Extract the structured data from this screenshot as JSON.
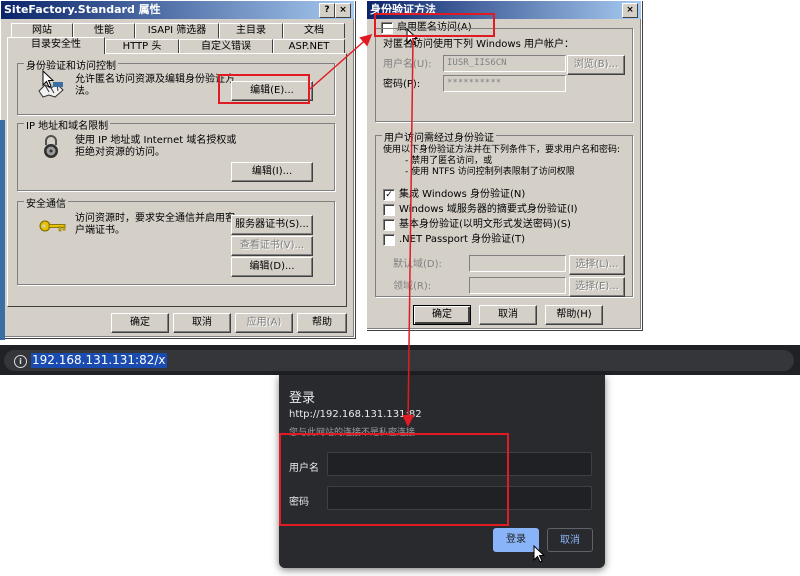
{
  "props_window": {
    "title": "SiteFactory.Standard 属性",
    "tabs_row1": [
      "网站",
      "性能",
      "ISAPI 筛选器",
      "主目录",
      "文档"
    ],
    "tabs_row2": [
      "目录安全性",
      "HTTP 头",
      "自定义错误",
      "ASP.NET"
    ],
    "auth_group": {
      "title": "身份验证和访问控制",
      "desc_line1": "允许匿名访问资源及编辑身份验证方",
      "desc_line2": "法。",
      "edit_label": "编辑(E)..."
    },
    "ip_group": {
      "title": "IP 地址和域名限制",
      "desc_line1": "使用 IP 地址或 Internet 域名授权或",
      "desc_line2": "拒绝对资源的访问。",
      "edit_label": "编辑(I)..."
    },
    "secure_group": {
      "title": "安全通信",
      "desc_line1": "访问资源时，要求安全通信并启用客",
      "desc_line2": "户端证书。",
      "server_cert_label": "服务器证书(S)...",
      "view_cert_label": "查看证书(V)...",
      "edit_label": "编辑(D)..."
    },
    "buttons": {
      "ok": "确定",
      "cancel": "取消",
      "apply": "应用(A)",
      "help": "帮助"
    }
  },
  "auth_window": {
    "title": "身份验证方法",
    "anon_checkbox_label": "启用匿名访问(A)",
    "anon_checked": false,
    "anon_desc": "对匿名访问使用下列 Windows 用户帐户：",
    "username_label": "用户名(U):",
    "username_value": "IUSR_IIS6CN",
    "browse_label": "浏览(B)...",
    "password_label": "密码(P):",
    "password_value": "**********",
    "auth_group": {
      "title": "用户访问需经过身份验证",
      "desc_line1": "使用以下身份验证方法并在下列条件下，要求用户名和密码:",
      "desc_line2": "- 禁用了匿名访问，或",
      "desc_line3": "- 使用 NTFS 访问控制列表限制了访问权限",
      "options": [
        {
          "label": "集成 Windows 身份验证(N)",
          "checked": true
        },
        {
          "label": "Windows 域服务器的摘要式身份验证(I)",
          "checked": false
        },
        {
          "label": "基本身份验证(以明文形式发送密码)(S)",
          "checked": false
        },
        {
          "label": ".NET Passport 身份验证(T)",
          "checked": false
        }
      ],
      "default_domain_label": "默认域(D):",
      "realm_label": "领域(R):",
      "select_label": "选择(L)...",
      "select2_label": "选择(E)..."
    },
    "buttons": {
      "ok": "确定",
      "cancel": "取消",
      "help": "帮助(H)"
    }
  },
  "browser": {
    "address": "192.168.131.131:82/x"
  },
  "login_dialog": {
    "title": "登录",
    "url": "http://192.168.131.131:82",
    "warning": "您与此网站的连接不是私密连接",
    "username_label": "用户名",
    "password_label": "密码",
    "login_button": "登录",
    "cancel_button": "取消",
    "accent_color": "#8ab4f8"
  },
  "colors": {
    "annotation_red": "#e01b24",
    "win_face": "#d4d0c8",
    "title_blue": "#0a246a"
  }
}
